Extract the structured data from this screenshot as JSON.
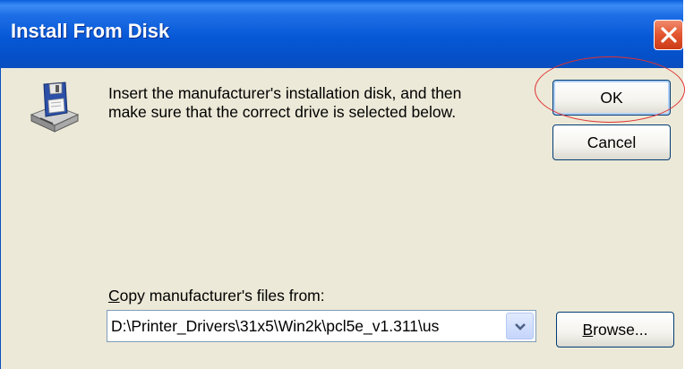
{
  "window": {
    "title": "Install From Disk"
  },
  "dialog": {
    "message_line1": "Insert the manufacturer's installation disk, and then",
    "message_line2": "make sure that the correct drive is selected below.",
    "ok_label": "OK",
    "cancel_label": "Cancel",
    "copy_label_mnemonic": "C",
    "copy_label_rest": "opy manufacturer's files from:",
    "path_value": "D:\\Printer_Drivers\\31x5\\Win2k\\pcl5e_v1.311\\us",
    "browse_mnemonic": "B",
    "browse_rest": "rowse..."
  },
  "icons": {
    "close": "close-icon",
    "disk": "disk-drive-icon",
    "dropdown": "chevron-down-icon"
  },
  "colors": {
    "titlebar": "#0758d6",
    "close_button": "#e2552f",
    "dialog_background": "#ece9d8",
    "annotation_circle": "#e03030"
  }
}
